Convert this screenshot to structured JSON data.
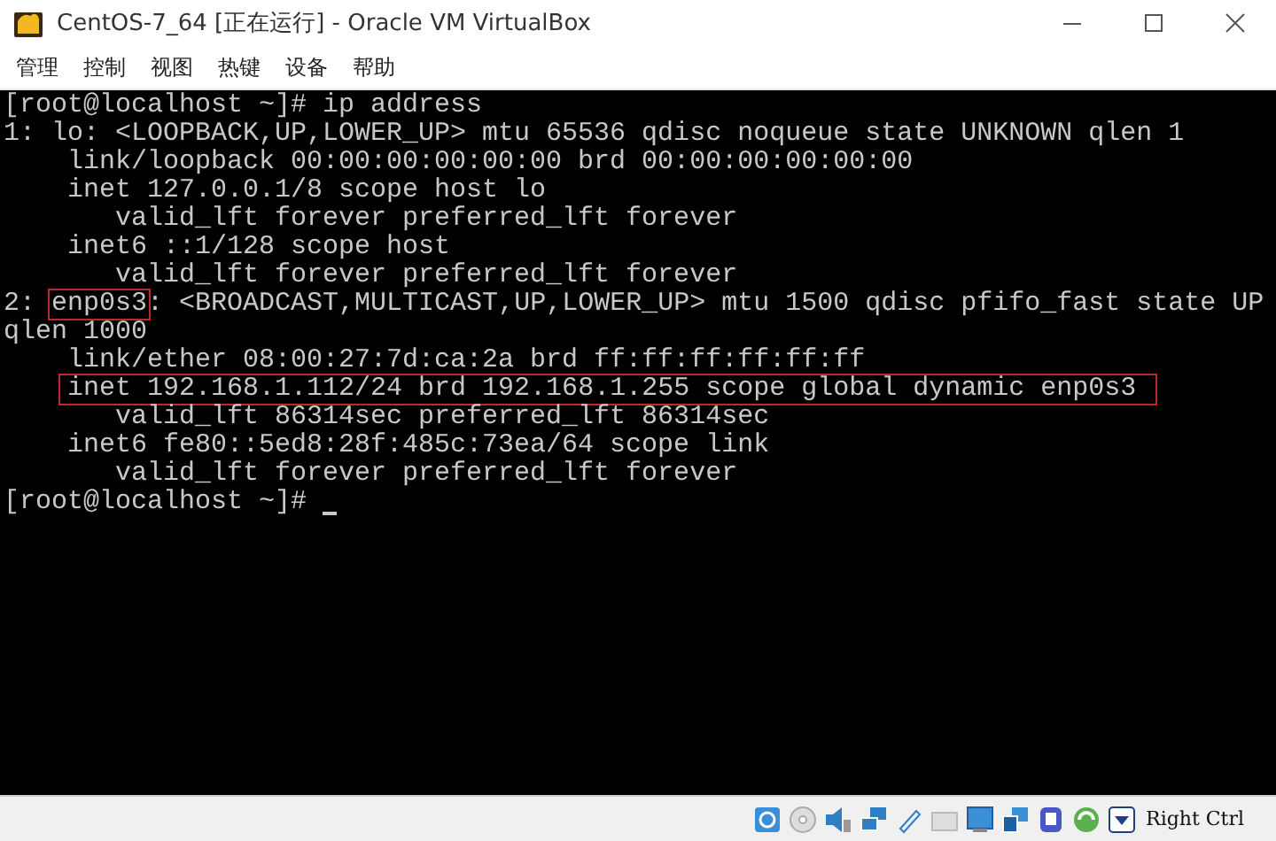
{
  "window": {
    "title": "CentOS-7_64 [正在运行] - Oracle VM VirtualBox"
  },
  "menu": [
    "管理",
    "控制",
    "视图",
    "热键",
    "设备",
    "帮助"
  ],
  "terminal": {
    "lines": [
      {
        "segments": [
          {
            "text": "[root@localhost ~]# ip address",
            "boxed": false
          }
        ]
      },
      {
        "segments": [
          {
            "text": "1: lo: <LOOPBACK,UP,LOWER_UP> mtu 65536 qdisc noqueue state UNKNOWN qlen 1",
            "boxed": false
          }
        ]
      },
      {
        "segments": [
          {
            "text": "    link/loopback 00:00:00:00:00:00 brd 00:00:00:00:00:00",
            "boxed": false
          }
        ]
      },
      {
        "segments": [
          {
            "text": "    inet 127.0.0.1/8 scope host lo",
            "boxed": false
          }
        ]
      },
      {
        "segments": [
          {
            "text": "       valid_lft forever preferred_lft forever",
            "boxed": false
          }
        ]
      },
      {
        "segments": [
          {
            "text": "    inet6 ::1/128 scope host",
            "boxed": false
          }
        ]
      },
      {
        "segments": [
          {
            "text": "       valid_lft forever preferred_lft forever",
            "boxed": false
          }
        ]
      },
      {
        "segments": [
          {
            "text": "2: ",
            "boxed": false
          },
          {
            "text": "enp0s3",
            "boxed": true
          },
          {
            "text": ": <BROADCAST,MULTICAST,UP,LOWER_UP> mtu 1500 qdisc pfifo_fast state UP",
            "boxed": false
          }
        ]
      },
      {
        "segments": [
          {
            "text": "qlen 1000",
            "boxed": false
          }
        ]
      },
      {
        "segments": [
          {
            "text": "    link/ether 08:00:27:7d:ca:2a brd ff:ff:ff:ff:ff:ff",
            "boxed": false
          }
        ]
      },
      {
        "segments": [
          {
            "text": "    inet 192.168.1.112/24 brd 192.168.1.255 scope global dynamic enp0s3",
            "boxed": true
          }
        ]
      },
      {
        "segments": [
          {
            "text": "       valid_lft 86314sec preferred_lft 86314sec",
            "boxed": false
          }
        ]
      },
      {
        "segments": [
          {
            "text": "    inet6 fe80::5ed8:28f:485c:73ea/64 scope link",
            "boxed": false
          }
        ]
      },
      {
        "segments": [
          {
            "text": "       valid_lft forever preferred_lft forever",
            "boxed": false
          }
        ]
      },
      {
        "segments": [
          {
            "text": "[root@localhost ~]# ",
            "boxed": false
          }
        ],
        "cursor": true
      }
    ]
  },
  "status_bar": {
    "host_key": "Right Ctrl"
  }
}
